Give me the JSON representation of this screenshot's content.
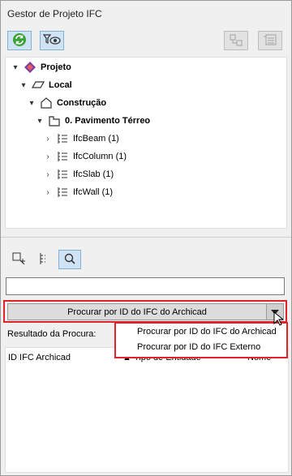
{
  "window": {
    "title": "Gestor de Projeto IFC"
  },
  "toolbar": {
    "refresh_icon": "refresh-icon",
    "filter_view_icon": "filter-eye-icon",
    "add_entity_icon": "add-entity-icon",
    "entity_list_icon": "entity-list-icon"
  },
  "tree": {
    "project": "Projeto",
    "site": "Local",
    "building": "Construção",
    "storey": "0. Pavimento Térreo",
    "items": [
      "IfcBeam (1)",
      "IfcColumn (1)",
      "IfcSlab (1)",
      "IfcWall (1)"
    ]
  },
  "search": {
    "input_value": "",
    "mode_selected": "Procurar por ID do IFC do Archicad",
    "options": [
      "Procurar por ID do IFC do Archicad",
      "Procurar por ID do IFC Externo"
    ]
  },
  "results": {
    "label": "Resultado da Procura:",
    "columns": [
      "ID IFC Archicad",
      "Tipo de Entidade",
      "Nome"
    ]
  },
  "colors": {
    "highlight": "#e0242a",
    "accent": "#cfe3f4",
    "refresh_green": "#3aa335"
  }
}
